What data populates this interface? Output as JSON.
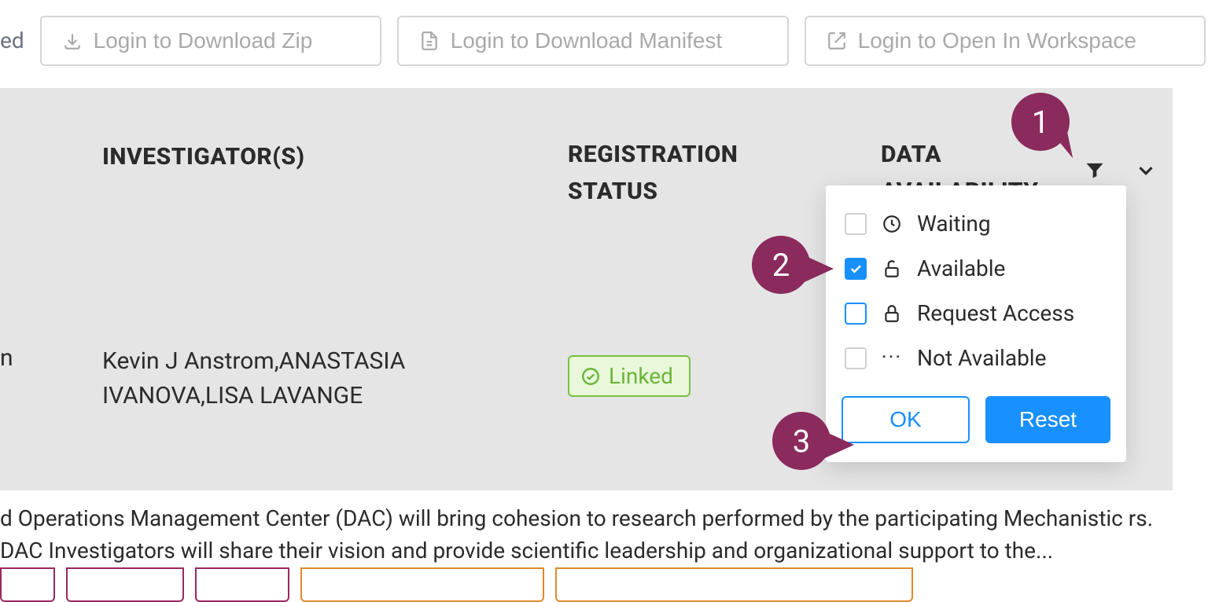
{
  "top_left_fragment": "ed",
  "buttons": {
    "download_zip": "Login to Download Zip",
    "download_manifest": "Login to Download Manifest",
    "open_workspace": "Login to Open In Workspace"
  },
  "columns": {
    "investigators": "INVESTIGATOR(S)",
    "registration_status_l1": "REGISTRATION",
    "registration_status_l2": "STATUS",
    "data_availability_l1": "DATA",
    "data_availability_l2": "AVAILABILITY"
  },
  "row": {
    "left_fragment": "n",
    "investigators": "Kevin J Anstrom,ANASTASIA IVANOVA,LISA LAVANGE",
    "status_label": "Linked"
  },
  "filter": {
    "options": [
      {
        "label": "Waiting",
        "icon": "clock",
        "checked": false,
        "blueBorder": false
      },
      {
        "label": "Available",
        "icon": "unlock",
        "checked": true,
        "blueBorder": false
      },
      {
        "label": "Request Access",
        "icon": "lock",
        "checked": false,
        "blueBorder": true
      },
      {
        "label": "Not Available",
        "icon": "dots",
        "checked": false,
        "blueBorder": false
      }
    ],
    "ok": "OK",
    "reset": "Reset"
  },
  "bottom_text": "d Operations Management Center (DAC) will bring cohesion to research performed by the participating Mechanistic rs. DAC Investigators will share their vision and provide scientific leadership and organizational support to the...",
  "callouts": {
    "c1": "1",
    "c2": "2",
    "c3": "3"
  }
}
